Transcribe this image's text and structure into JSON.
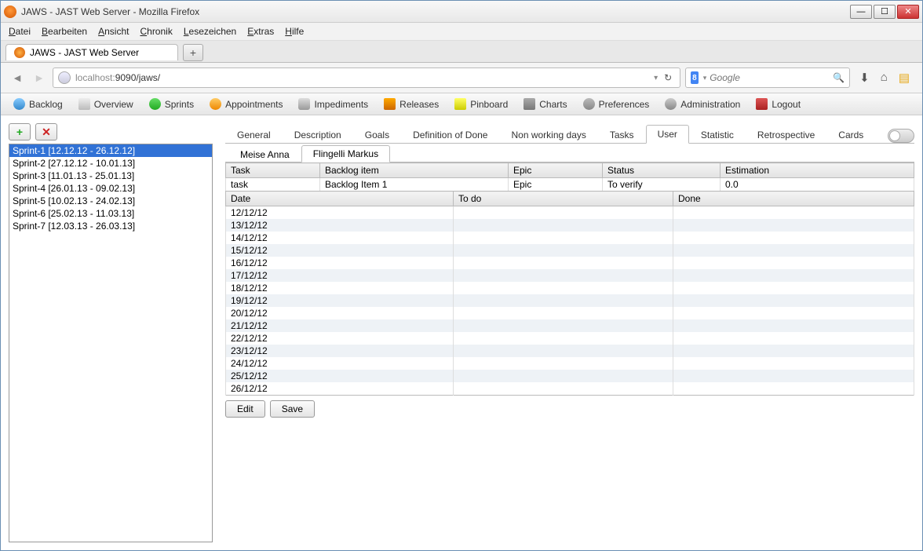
{
  "window": {
    "title": "JAWS - JAST Web Server - Mozilla Firefox"
  },
  "menubar": [
    "Datei",
    "Bearbeiten",
    "Ansicht",
    "Chronik",
    "Lesezeichen",
    "Extras",
    "Hilfe"
  ],
  "tab": {
    "title": "JAWS - JAST Web Server"
  },
  "url": {
    "host": "localhost:",
    "path": "9090/jaws/"
  },
  "search": {
    "placeholder": "Google",
    "engine": "8"
  },
  "toolbar": [
    {
      "label": "Backlog",
      "icon": "i-backlog",
      "name": "toolbar-backlog"
    },
    {
      "label": "Overview",
      "icon": "i-overview",
      "name": "toolbar-overview"
    },
    {
      "label": "Sprints",
      "icon": "i-sprints",
      "name": "toolbar-sprints"
    },
    {
      "label": "Appointments",
      "icon": "i-appointments",
      "name": "toolbar-appointments"
    },
    {
      "label": "Impediments",
      "icon": "i-impediments",
      "name": "toolbar-impediments"
    },
    {
      "label": "Releases",
      "icon": "i-releases",
      "name": "toolbar-releases"
    },
    {
      "label": "Pinboard",
      "icon": "i-pinboard",
      "name": "toolbar-pinboard"
    },
    {
      "label": "Charts",
      "icon": "i-charts",
      "name": "toolbar-charts"
    },
    {
      "label": "Preferences",
      "icon": "i-preferences",
      "name": "toolbar-preferences"
    },
    {
      "label": "Administration",
      "icon": "i-admin",
      "name": "toolbar-administration"
    },
    {
      "label": "Logout",
      "icon": "i-logout",
      "name": "toolbar-logout"
    }
  ],
  "sprints": [
    {
      "label": "Sprint-1 [12.12.12 - 26.12.12]",
      "selected": true
    },
    {
      "label": "Sprint-2 [27.12.12 - 10.01.13]",
      "selected": false
    },
    {
      "label": "Sprint-3 [11.01.13 - 25.01.13]",
      "selected": false
    },
    {
      "label": "Sprint-4 [26.01.13 - 09.02.13]",
      "selected": false
    },
    {
      "label": "Sprint-5 [10.02.13 - 24.02.13]",
      "selected": false
    },
    {
      "label": "Sprint-6 [25.02.13 - 11.03.13]",
      "selected": false
    },
    {
      "label": "Sprint-7 [12.03.13 - 26.03.13]",
      "selected": false
    }
  ],
  "maintabs": [
    "General",
    "Description",
    "Goals",
    "Definition of Done",
    "Non working days",
    "Tasks",
    "User",
    "Statistic",
    "Retrospective",
    "Cards"
  ],
  "main_active": "User",
  "subtabs": [
    "Meise Anna",
    "Flingelli Markus"
  ],
  "sub_active": "Flingelli Markus",
  "task_headers": [
    "Task",
    "Backlog item",
    "Epic",
    "Status",
    "Estimation"
  ],
  "task_row": [
    "task",
    "Backlog Item 1",
    "Epic",
    "To verify",
    "0.0"
  ],
  "date_headers": [
    "Date",
    "To do",
    "Done"
  ],
  "dates": [
    "12/12/12",
    "13/12/12",
    "14/12/12",
    "15/12/12",
    "16/12/12",
    "17/12/12",
    "18/12/12",
    "19/12/12",
    "20/12/12",
    "21/12/12",
    "22/12/12",
    "23/12/12",
    "24/12/12",
    "25/12/12",
    "26/12/12"
  ],
  "buttons": {
    "edit": "Edit",
    "save": "Save"
  }
}
